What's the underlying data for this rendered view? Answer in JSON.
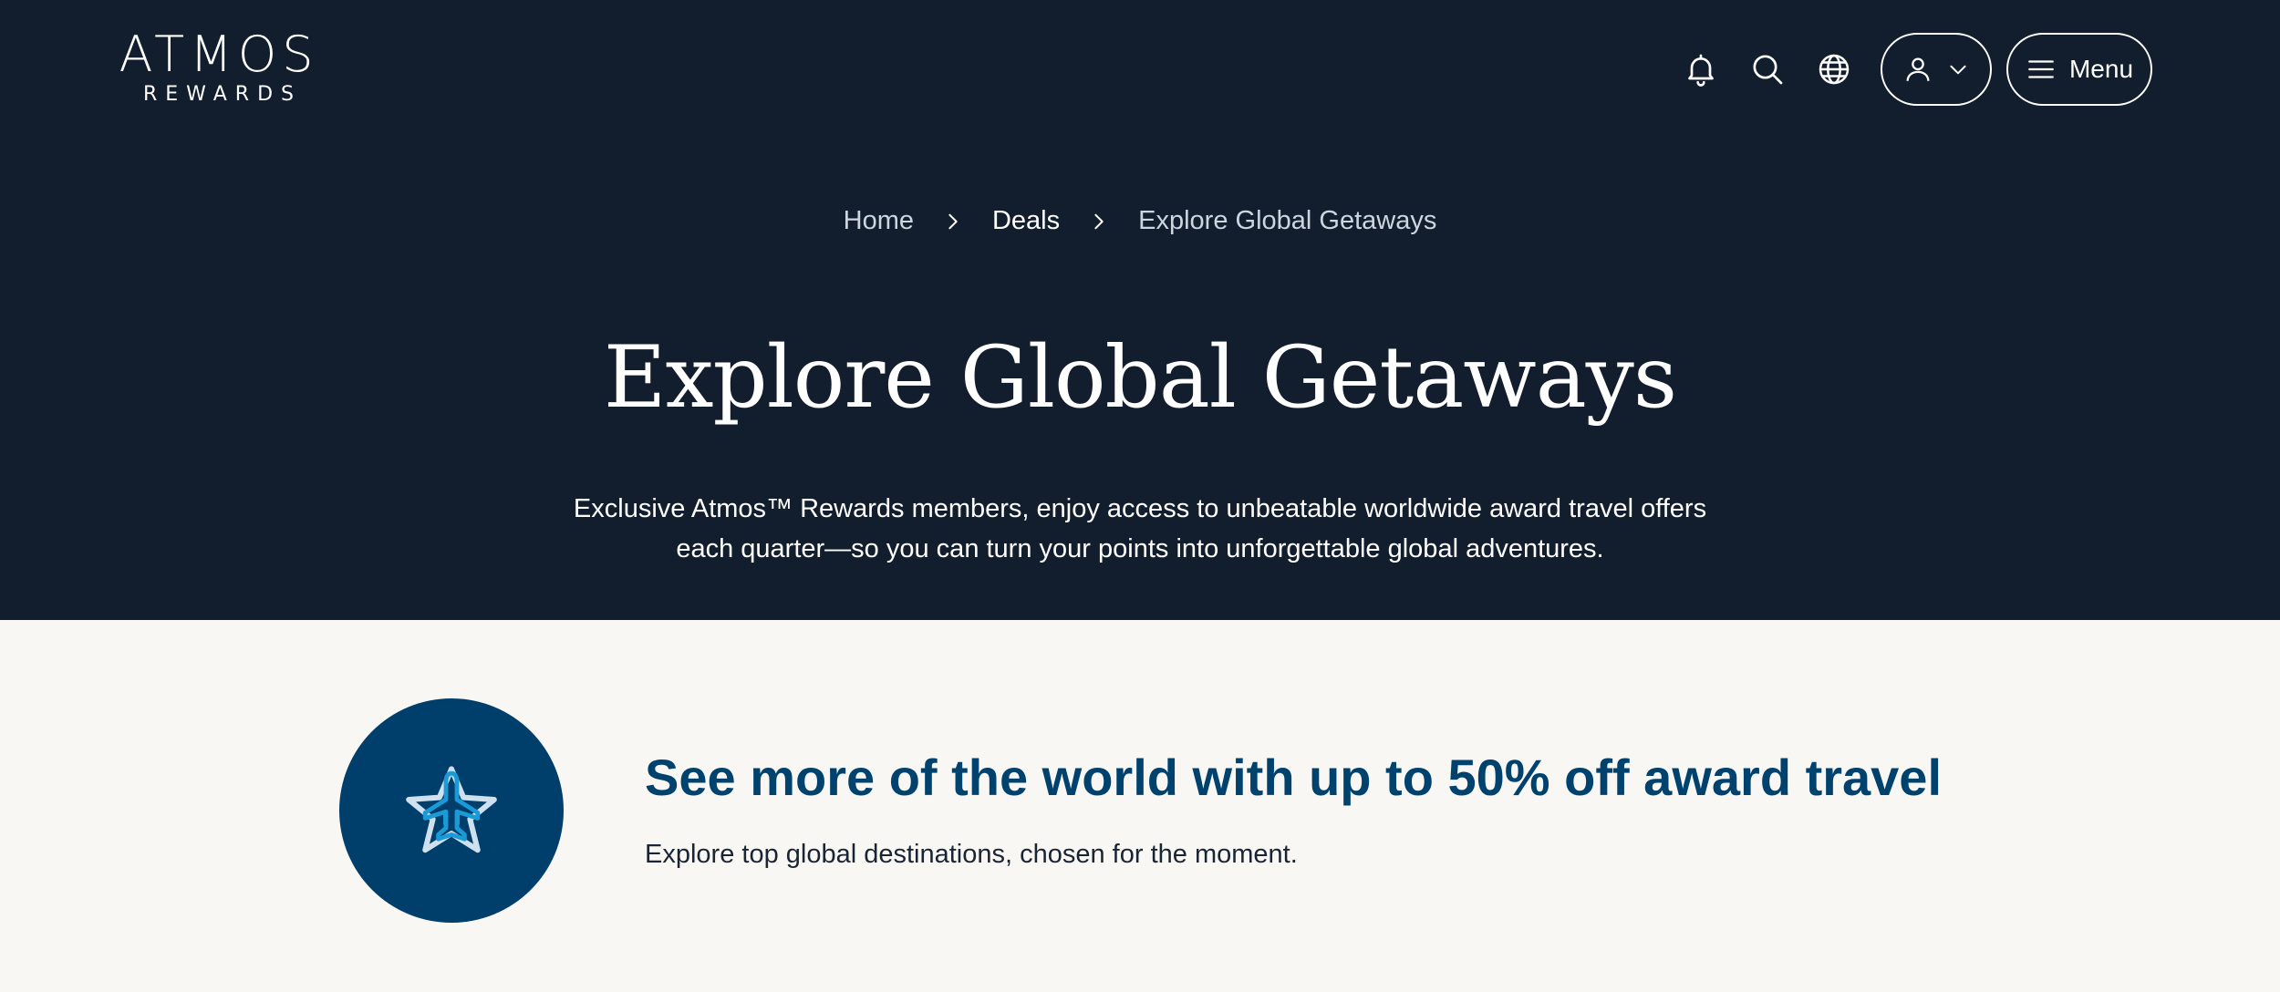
{
  "header": {
    "logo_main": "ATMOS",
    "logo_sub": "REWARDS",
    "icons": [
      "bell-icon",
      "search-icon",
      "globe-icon",
      "user-icon",
      "chevron-down-icon",
      "hamburger-icon"
    ],
    "menu_label": "Menu"
  },
  "breadcrumb": {
    "home": "Home",
    "deals": "Deals",
    "current": "Explore Global Getaways"
  },
  "hero": {
    "title": "Explore Global Getaways",
    "description_line1": "Exclusive Atmos™ Rewards members, enjoy access to unbeatable worldwide award travel offers",
    "description_line2": "each quarter—so you can turn your points into unforgettable global adventures."
  },
  "promo": {
    "icon": "star-plane-icon",
    "title": "See more of the world with up to 50% off award travel",
    "subtitle": "Explore top global destinations, chosen for the moment."
  },
  "colors": {
    "hero_bg": "#121e2e",
    "page_bg": "#f9f7f4",
    "brand_blue": "#003e6b",
    "accent_blue": "#1a9ad6"
  }
}
